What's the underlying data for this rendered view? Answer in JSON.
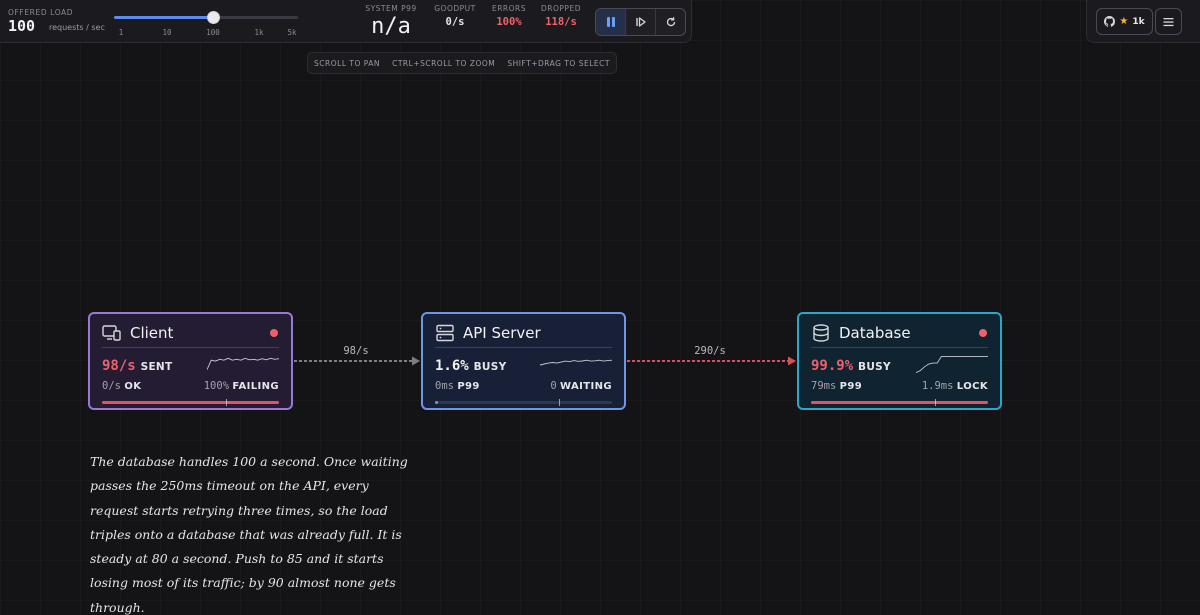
{
  "toolbar": {
    "offered_load_label": "OFFERED LOAD",
    "offered_load_value": "100",
    "offered_load_unit": "requests / sec",
    "slider_ticks": [
      "1",
      "10",
      "100",
      "1k",
      "5k"
    ],
    "slider_fraction": 0.54,
    "stats": {
      "system_p99_label": "SYSTEM P99",
      "system_p99_value": "n/a",
      "goodput_label": "GOODPUT",
      "goodput_value": "0/s",
      "errors_label": "ERRORS",
      "errors_value": "100%",
      "dropped_label": "DROPPED",
      "dropped_value": "118/s"
    },
    "controls": [
      "pause-icon",
      "step-icon",
      "reset-icon"
    ]
  },
  "help_bar": [
    "SCROLL TO PAN",
    "CTRL+SCROLL TO ZOOM",
    "SHIFT+DRAG TO SELECT"
  ],
  "github": {
    "stars": "1k"
  },
  "nodes": {
    "client": {
      "title": "Client",
      "big_value": "98/s",
      "big_unit": "SENT",
      "small_left_value": "0/s",
      "small_left_unit": "OK",
      "small_right_value": "100%",
      "small_right_unit": "FAILING",
      "bar_fraction": 1.0,
      "sparkline": [
        0.8,
        0.3,
        0.35,
        0.25,
        0.3,
        0.2,
        0.3,
        0.25,
        0.3,
        0.2,
        0.28,
        0.25,
        0.3,
        0.22,
        0.28,
        0.2,
        0.25,
        0.22
      ]
    },
    "api": {
      "title": "API Server",
      "big_value": "1.6%",
      "big_unit": "BUSY",
      "small_left_value": "0ms",
      "small_left_unit": "P99",
      "small_right_value": "0",
      "small_right_unit": "WAITING",
      "bar_fraction": 0.016,
      "sparkline": [
        0.55,
        0.5,
        0.45,
        0.42,
        0.45,
        0.4,
        0.35,
        0.38,
        0.32,
        0.36,
        0.34,
        0.3,
        0.35,
        0.33,
        0.3,
        0.35,
        0.32,
        0.3
      ]
    },
    "db": {
      "title": "Database",
      "big_value": "99.9%",
      "big_unit": "BUSY",
      "small_left_value": "79ms",
      "small_left_unit": "P99",
      "small_right_value": "1.9ms",
      "small_right_unit": "LOCK",
      "bar_fraction": 1.0,
      "sparkline": [
        0.95,
        0.85,
        0.65,
        0.5,
        0.45,
        0.45,
        0.1,
        0.1,
        0.1,
        0.1,
        0.1,
        0.1,
        0.1,
        0.1,
        0.1,
        0.1,
        0.1,
        0.1
      ]
    }
  },
  "edges": {
    "client_to_api": "98/s",
    "api_to_db": "290/s"
  },
  "note": "The database handles 100 a second. Once waiting passes the 250ms timeout on the API, every request starts retrying three times, so the load triples onto a database that was already full. It is steady at 80 a second. Push to 85 and it starts losing most of its traffic; by 90 almost none gets through.",
  "colors": {
    "client_border": "#9a78d8",
    "api_border": "#6f96e6",
    "db_border": "#2aa7c9",
    "error_red": "#f0606a",
    "accent_blue": "#5b8cf0"
  }
}
